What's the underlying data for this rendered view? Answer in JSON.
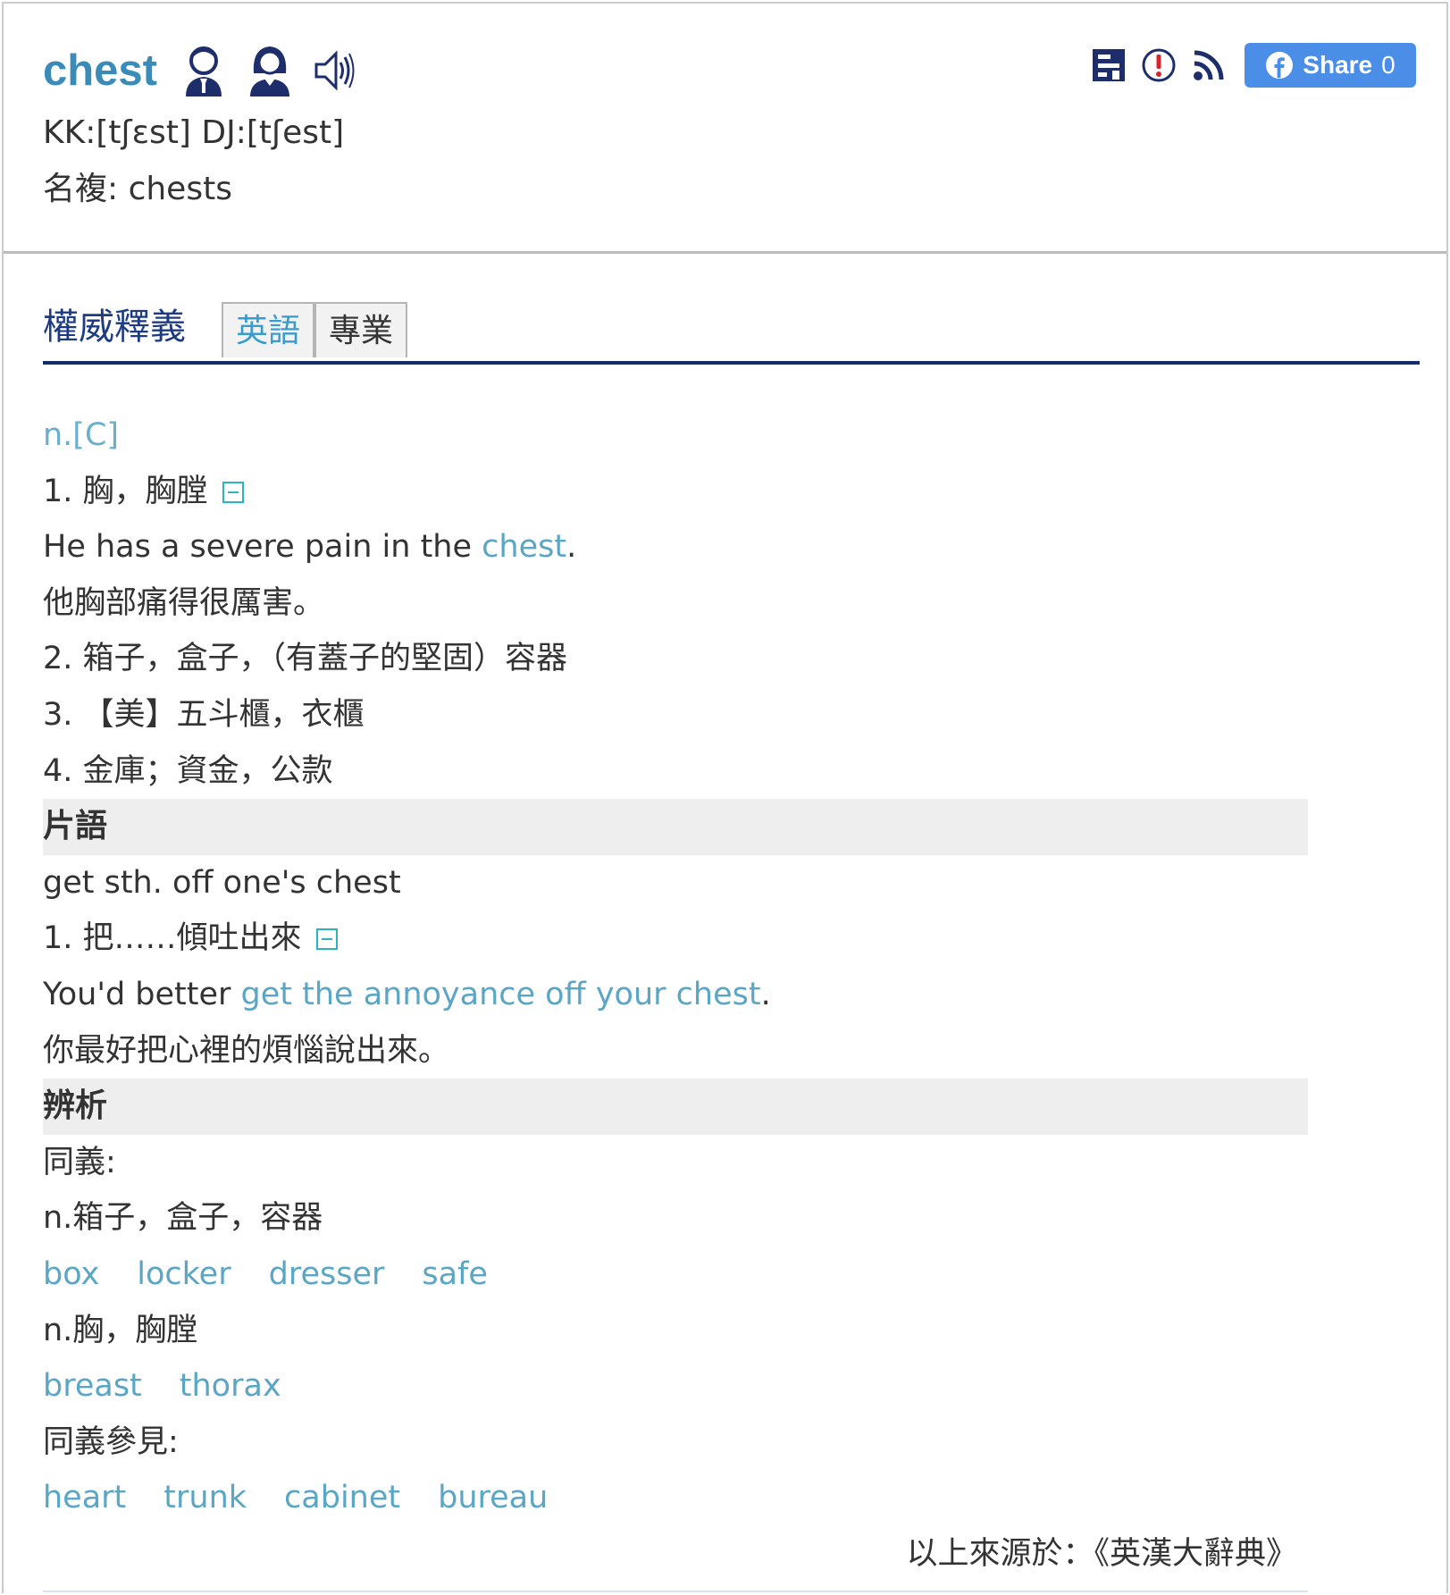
{
  "header": {
    "word": "chest",
    "phonetic": "KK:[tʃɛst] DJ:[tʃest]",
    "plural": "名複: chests",
    "share_label": "Share",
    "share_count": "0",
    "icons": [
      "male-voice-icon",
      "female-voice-icon",
      "speaker-icon",
      "dictionary-icon",
      "report-icon",
      "rss-icon",
      "facebook-icon"
    ]
  },
  "tabs": {
    "title": "權威釋義",
    "items": [
      {
        "label": "英語",
        "active": true
      },
      {
        "label": "專業",
        "active": false
      }
    ]
  },
  "definition": {
    "pos": "n.[C]",
    "senses": [
      "1. 胸，胸膛",
      "2. 箱子，盒子，（有蓋子的堅固）容器",
      "3. 【美】五斗櫃，衣櫃",
      "4. 金庫；資金，公款"
    ],
    "example_before": "He has a severe pain in the ",
    "example_highlight": "chest",
    "example_after": ".",
    "example_translation": "他胸部痛得很厲害。"
  },
  "phrases": {
    "heading": "片語",
    "phrase": "get sth. off one's chest",
    "sense": "1. 把……傾吐出來",
    "example_before": "You'd better ",
    "example_highlight": "get the annoyance off your chest",
    "example_after": ".",
    "example_translation": "你最好把心裡的煩惱說出來。"
  },
  "analysis": {
    "heading": "辨析",
    "synonyms_label": "同義:",
    "group1_label": "n.箱子，盒子，容器",
    "group1_words": [
      "box",
      "locker",
      "dresser",
      "safe"
    ],
    "group2_label": "n.胸，胸膛",
    "group2_words": [
      "breast",
      "thorax"
    ],
    "see_also_label": "同義參見:",
    "see_also_words": [
      "heart",
      "trunk",
      "cabinet",
      "bureau"
    ]
  },
  "source": "以上來源於：《英漢大辭典》",
  "colors": {
    "title_blue": "#3a8bb8",
    "link_blue": "#5aa6c4",
    "tab_navy": "#1d3b83",
    "facebook_blue": "#4a8ee8",
    "section_gray": "#eeeeee"
  }
}
